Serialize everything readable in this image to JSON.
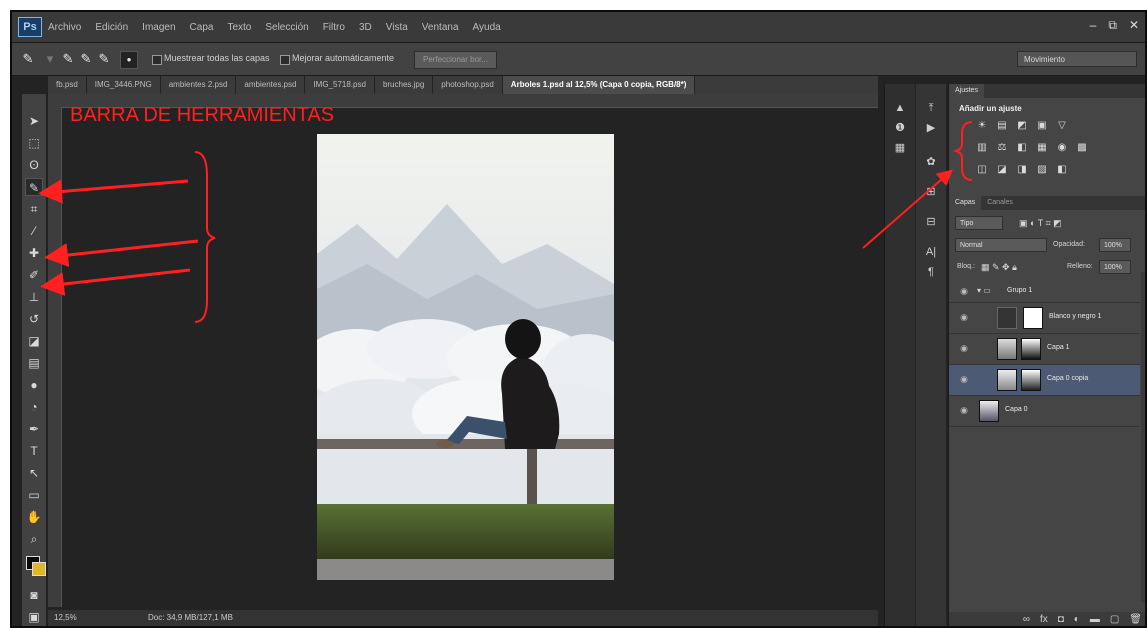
{
  "app": {
    "logo": "Ps",
    "window_controls": [
      "–",
      "⧉",
      "✕"
    ]
  },
  "menu": [
    "Archivo",
    "Edición",
    "Imagen",
    "Capa",
    "Texto",
    "Selección",
    "Filtro",
    "3D",
    "Vista",
    "Ventana",
    "Ayuda"
  ],
  "options_bar": {
    "sample_all_layers": "Muestrear todas las capas",
    "auto_enhance": "Mejorar automáticamente",
    "refine_edge": "Perfeccionar bor...",
    "workspace": "Movimiento"
  },
  "tabs": [
    "fb.psd",
    "IMG_3446.PNG",
    "ambientes 2.psd",
    "ambientes.psd",
    "IMG_5718.psd",
    "bruches.jpg",
    "photoshop.psd",
    "Arboles 1.psd al 12,5% (Capa 0 copia, RGB/8*)"
  ],
  "annotation": {
    "title": "BARRA DE HERRAMIENTAS",
    "color": "#ff2020"
  },
  "status": {
    "zoom": "12,5%",
    "doc": "Doc: 34,9 MB/127,1 MB"
  },
  "panels": {
    "adjust_tabs": [
      "Ajustes"
    ],
    "adjust_title": "Añadir un ajuste",
    "adjust_icons": [
      [
        "☀",
        "▤",
        "◩",
        "▣",
        "▽"
      ],
      [
        "▥",
        "⚖",
        "◧",
        "▦",
        "◉",
        "▩"
      ],
      [
        "◫",
        "◪",
        "◨",
        "▨",
        "◧"
      ]
    ],
    "layer_tabs": [
      "Capas",
      "Canales"
    ],
    "kind": "Tipo",
    "blend_mode": "Normal",
    "opacity_label": "Opacidad:",
    "opacity_value": "100%",
    "lock_label": "Bloq.:",
    "fill_label": "Relleno:",
    "fill_value": "100%",
    "layers": [
      {
        "name": "Grupo 1",
        "type": "group"
      },
      {
        "name": "Blanco y negro 1",
        "type": "adjustment"
      },
      {
        "name": "Capa 1",
        "type": "layer"
      },
      {
        "name": "Capa 0 copia",
        "type": "layer",
        "selected": true
      },
      {
        "name": "Capa 0",
        "type": "layer"
      }
    ]
  },
  "icons": [
    "move-tool-icon",
    "marquee-tool-icon",
    "lasso-tool-icon",
    "quick-select-tool-icon",
    "crop-tool-icon",
    "eyedropper-tool-icon",
    "healing-brush-icon",
    "brush-tool-icon",
    "clone-stamp-icon",
    "history-brush-icon",
    "eraser-tool-icon",
    "gradient-tool-icon",
    "blur-tool-icon",
    "dodge-tool-icon",
    "pen-tool-icon",
    "type-tool-icon",
    "path-select-icon",
    "shape-tool-icon",
    "hand-tool-icon",
    "zoom-tool-icon"
  ]
}
